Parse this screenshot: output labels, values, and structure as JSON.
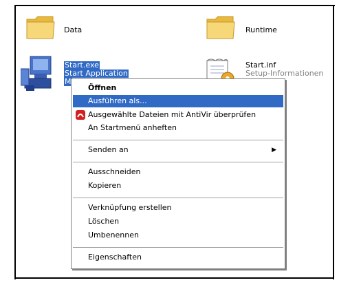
{
  "desktop": {
    "files": [
      {
        "name": "Data",
        "icon": "folder-icon"
      },
      {
        "name": "Runtime",
        "icon": "folder-icon"
      },
      {
        "name": "Start.exe",
        "desc": "Start Application",
        "extra": "M",
        "icon": "computer-setup-icon"
      },
      {
        "name": "Start.inf",
        "desc": "Setup-Informationen",
        "icon": "setup-info-icon"
      }
    ]
  },
  "context_menu": {
    "open": "Öffnen",
    "run_as": "Ausführen als...",
    "antivir": "Ausgewählte Dateien mit AntiVir überprüfen",
    "pin_start": "An Startmenü anheften",
    "send_to": "Senden an",
    "cut": "Ausschneiden",
    "copy": "Kopieren",
    "create_shortcut": "Verknüpfung erstellen",
    "delete": "Löschen",
    "rename": "Umbenennen",
    "properties": "Eigenschaften"
  },
  "colors": {
    "selection": "#316ac5",
    "folder": "#f5d46a",
    "antivir_red": "#d22020"
  }
}
